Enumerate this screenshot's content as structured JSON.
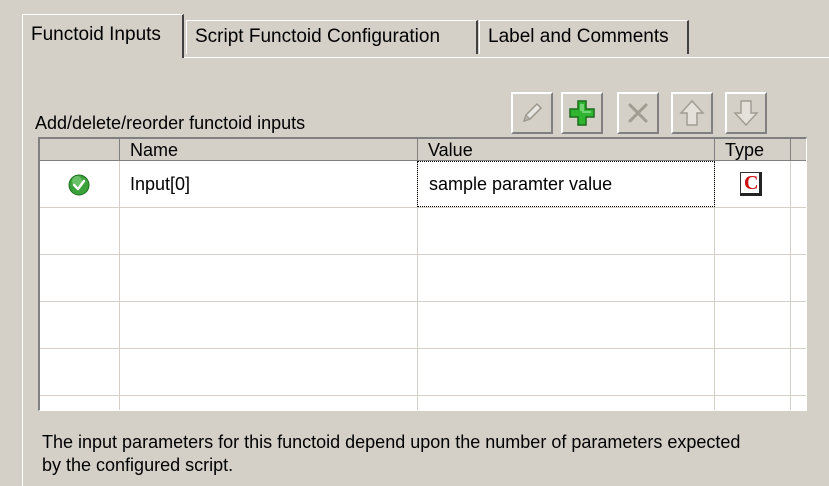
{
  "tabs": [
    {
      "label": "Functoid Inputs",
      "active": true
    },
    {
      "label": "Script Functoid Configuration",
      "active": false
    },
    {
      "label": "Label and Comments",
      "active": false
    }
  ],
  "section_label": "Add/delete/reorder functoid inputs",
  "toolbar": {
    "buttons": [
      {
        "icon": "pencil-icon",
        "enabled": false
      },
      {
        "icon": "plus-icon",
        "enabled": true
      },
      {
        "icon": "delete-x-icon",
        "enabled": false
      },
      {
        "icon": "arrow-up-icon",
        "enabled": false
      },
      {
        "icon": "arrow-down-icon",
        "enabled": false
      }
    ]
  },
  "grid": {
    "columns": [
      "Name",
      "Value",
      "Type"
    ],
    "rows": [
      {
        "status_icon": "check-circle-icon",
        "name": "Input[0]",
        "value": "sample paramter value",
        "type_icon": "constant-type-icon"
      }
    ]
  },
  "footer": "The input parameters for this functoid depend upon the number of parameters expected by the configured script.",
  "colors": {
    "background": "#d4d0c8",
    "grid_background": "#ffffff",
    "add_green": "#2fb52f",
    "check_green": "#3aa23a",
    "type_red": "#cc1111"
  }
}
